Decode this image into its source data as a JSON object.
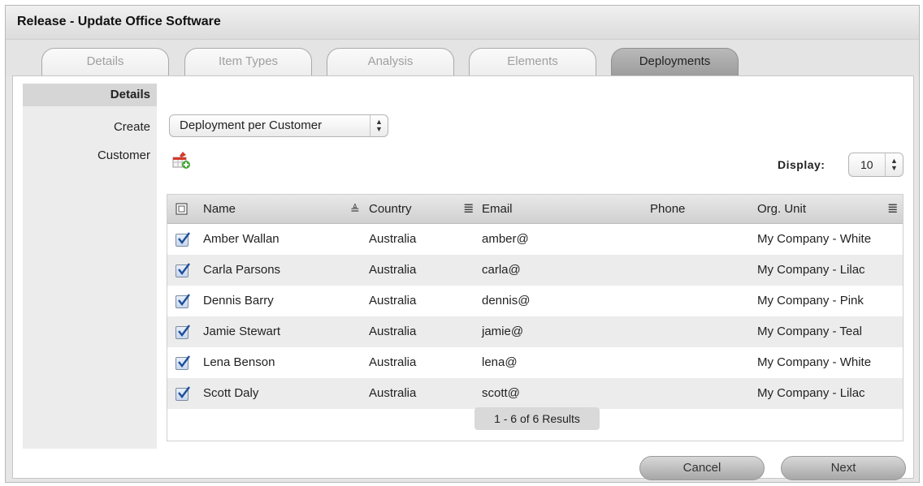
{
  "window": {
    "title": "Release - Update Office Software"
  },
  "tabs": [
    {
      "label": "Details"
    },
    {
      "label": "Item Types"
    },
    {
      "label": "Analysis"
    },
    {
      "label": "Elements"
    },
    {
      "label": "Deployments"
    }
  ],
  "sidebar": {
    "section": "Details",
    "create_label": "Create",
    "customer_label": "Customer"
  },
  "create_select": {
    "value": "Deployment per Customer"
  },
  "display": {
    "label": "Display:",
    "value": "10"
  },
  "icons": {
    "add_customer": "add-customer-icon",
    "sort": "sort-icon",
    "columns": "column-menu-icon"
  },
  "table": {
    "columns": [
      "Name",
      "Country",
      "Email",
      "Phone",
      "Org. Unit"
    ],
    "rows": [
      {
        "checked": true,
        "name": "Amber Wallan",
        "country": "Australia",
        "email": "amber@",
        "phone": "",
        "org": "My Company - White"
      },
      {
        "checked": true,
        "name": "Carla Parsons",
        "country": "Australia",
        "email": "carla@",
        "phone": "",
        "org": "My Company - Lilac"
      },
      {
        "checked": true,
        "name": "Dennis Barry",
        "country": "Australia",
        "email": "dennis@",
        "phone": "",
        "org": "My Company - Pink"
      },
      {
        "checked": true,
        "name": "Jamie Stewart",
        "country": "Australia",
        "email": "jamie@",
        "phone": "",
        "org": "My Company - Teal"
      },
      {
        "checked": true,
        "name": "Lena Benson",
        "country": "Australia",
        "email": "lena@",
        "phone": "",
        "org": "My Company - White"
      },
      {
        "checked": true,
        "name": "Scott Daly",
        "country": "Australia",
        "email": "scott@",
        "phone": "",
        "org": "My Company - Lilac"
      }
    ],
    "pager": "1 - 6 of 6 Results"
  },
  "buttons": {
    "cancel": "Cancel",
    "next": "Next"
  }
}
